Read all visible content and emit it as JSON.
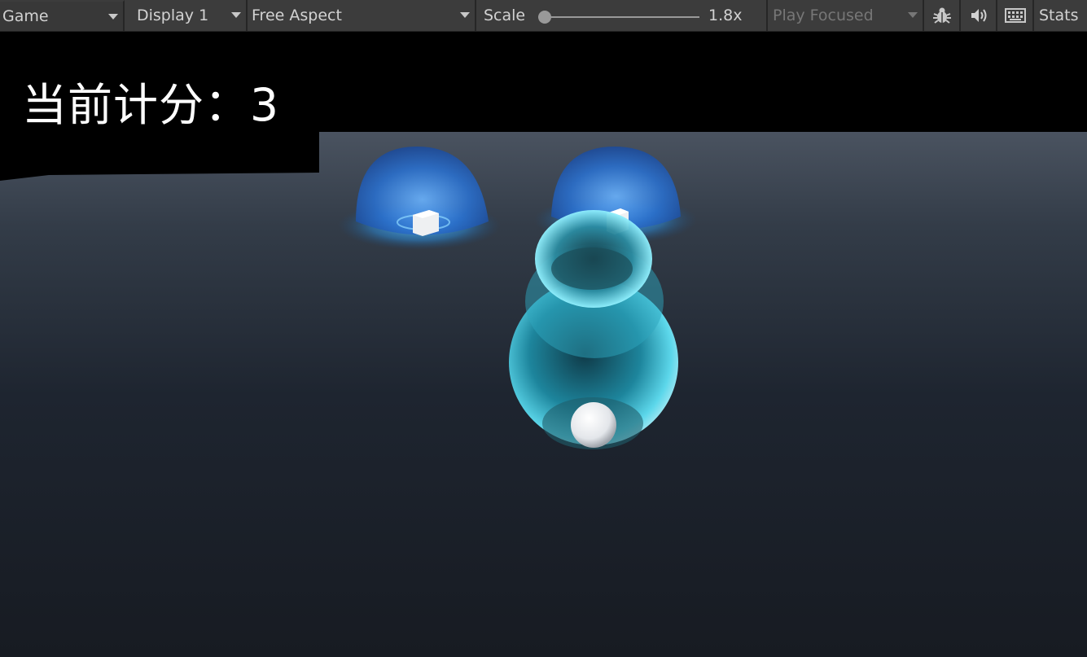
{
  "toolbar": {
    "view_label": "Game",
    "display_label": "Display 1",
    "aspect_label": "Free Aspect",
    "scale_label": "Scale",
    "scale_value": "1.8x",
    "scale_level": 0.0,
    "play_mode_label": "Play Focused",
    "stats_label": "Stats",
    "icons": [
      "bug-icon",
      "audio-icon",
      "keyboard-icon"
    ]
  },
  "game": {
    "score_text": "当前计分：3"
  }
}
